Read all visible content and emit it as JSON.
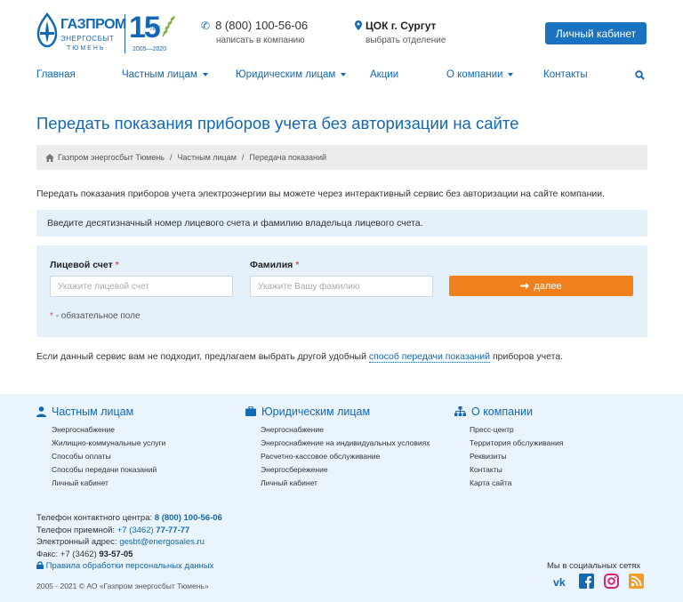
{
  "header": {
    "logo": {
      "name": "ГАЗПРОМ",
      "sub": "ЭНЕРГОСБЫТ",
      "city": "ТЮМЕНЬ",
      "anniv": "15",
      "anniv_sub": "ЛЕТ",
      "years": "2005—2020"
    },
    "phone": "8 (800) 100-56-06",
    "phone_sub": "написать в компанию",
    "office": "ЦОК г. Сургут",
    "office_sub": "выбрать отделение",
    "cabinet_label": "Личный кабинет"
  },
  "nav": {
    "items": [
      {
        "label": "Главная",
        "dropdown": false
      },
      {
        "label": "Частным лицам",
        "dropdown": true
      },
      {
        "label": "Юридическим лицам",
        "dropdown": true
      },
      {
        "label": "Акции",
        "dropdown": false
      },
      {
        "label": "О компании",
        "dropdown": true
      },
      {
        "label": "Контакты",
        "dropdown": false
      }
    ]
  },
  "page": {
    "title": "Передать показания приборов учета без авторизации на сайте",
    "breadcrumb": [
      "Газпром энергосбыт Тюмень",
      "Частным лицам",
      "Передача показаний"
    ],
    "intro": "Передать показания приборов учета электроэнергии вы можете через интерактивный сервис без авторизации на сайте компании.",
    "note": "Введите десятизначный номер лицевого счета и фамилию владельца лицевого счета."
  },
  "form": {
    "account_label": "Лицевой счет",
    "account_value": "",
    "account_placeholder": "Укажите лицевой счет",
    "surname_label": "Фамилия",
    "surname_value": "",
    "surname_placeholder": "Укажите Вашу фамилию",
    "required_mark": "*",
    "submit_label": "далее",
    "required_note": "- обязательное поле"
  },
  "alt": {
    "before": "Если данный сервис вам не подходит, предлагаем выбрать другой удобный",
    "link": "способ передачи показаний",
    "after": "приборов учета."
  },
  "footer": {
    "columns": [
      {
        "title": "Частным лицам",
        "items": [
          "Энергоснабжение",
          "Жилищно-коммунальные услуги",
          "Способы оплаты",
          "Способы передачи показаний",
          "Личный кабинет"
        ]
      },
      {
        "title": "Юридическим лицам",
        "items": [
          "Энергоснабжение",
          "Энергоснабжение на индивидуальных условиях",
          "Расчетно-кассовое обслуживание",
          "Энергосбережение",
          "Личный кабинет"
        ]
      },
      {
        "title": "О компании",
        "items": [
          "Пресс-центр",
          "Территория обслуживания",
          "Реквизиты",
          "Контакты",
          "Карта сайта"
        ]
      }
    ],
    "contact_center_label": "Телефон контактного центра:",
    "contact_center_phone": "8 (800) 100-56-06",
    "reception_label": "Телефон приемной:",
    "reception_code": "+7 (3462)",
    "reception_phone": "77-77-77",
    "email_label": "Электронный адрес:",
    "email": "gesbt@energosales.ru",
    "fax_label": "Факс:",
    "fax_code": "+7 (3462)",
    "fax_phone": "93-57-05",
    "privacy": "Правила обработки персональных данных",
    "copyright": "2005 - 2021 © АО «Газпром энергосбыт Тюмень»",
    "social_title": "Мы в социальных сетях"
  },
  "colors": {
    "brand": "#1268b3",
    "button": "#1a73c0",
    "accent": "#f07f1c",
    "panel": "#e4f1fb",
    "footer": "#e9f4fc"
  },
  "icons": [
    "phone-icon",
    "map-pin-icon",
    "search-icon",
    "home-icon",
    "arrow-right-icon",
    "user-icon",
    "briefcase-icon",
    "sitemap-icon",
    "lock-icon",
    "vk-icon",
    "facebook-icon",
    "instagram-icon",
    "rss-icon"
  ]
}
